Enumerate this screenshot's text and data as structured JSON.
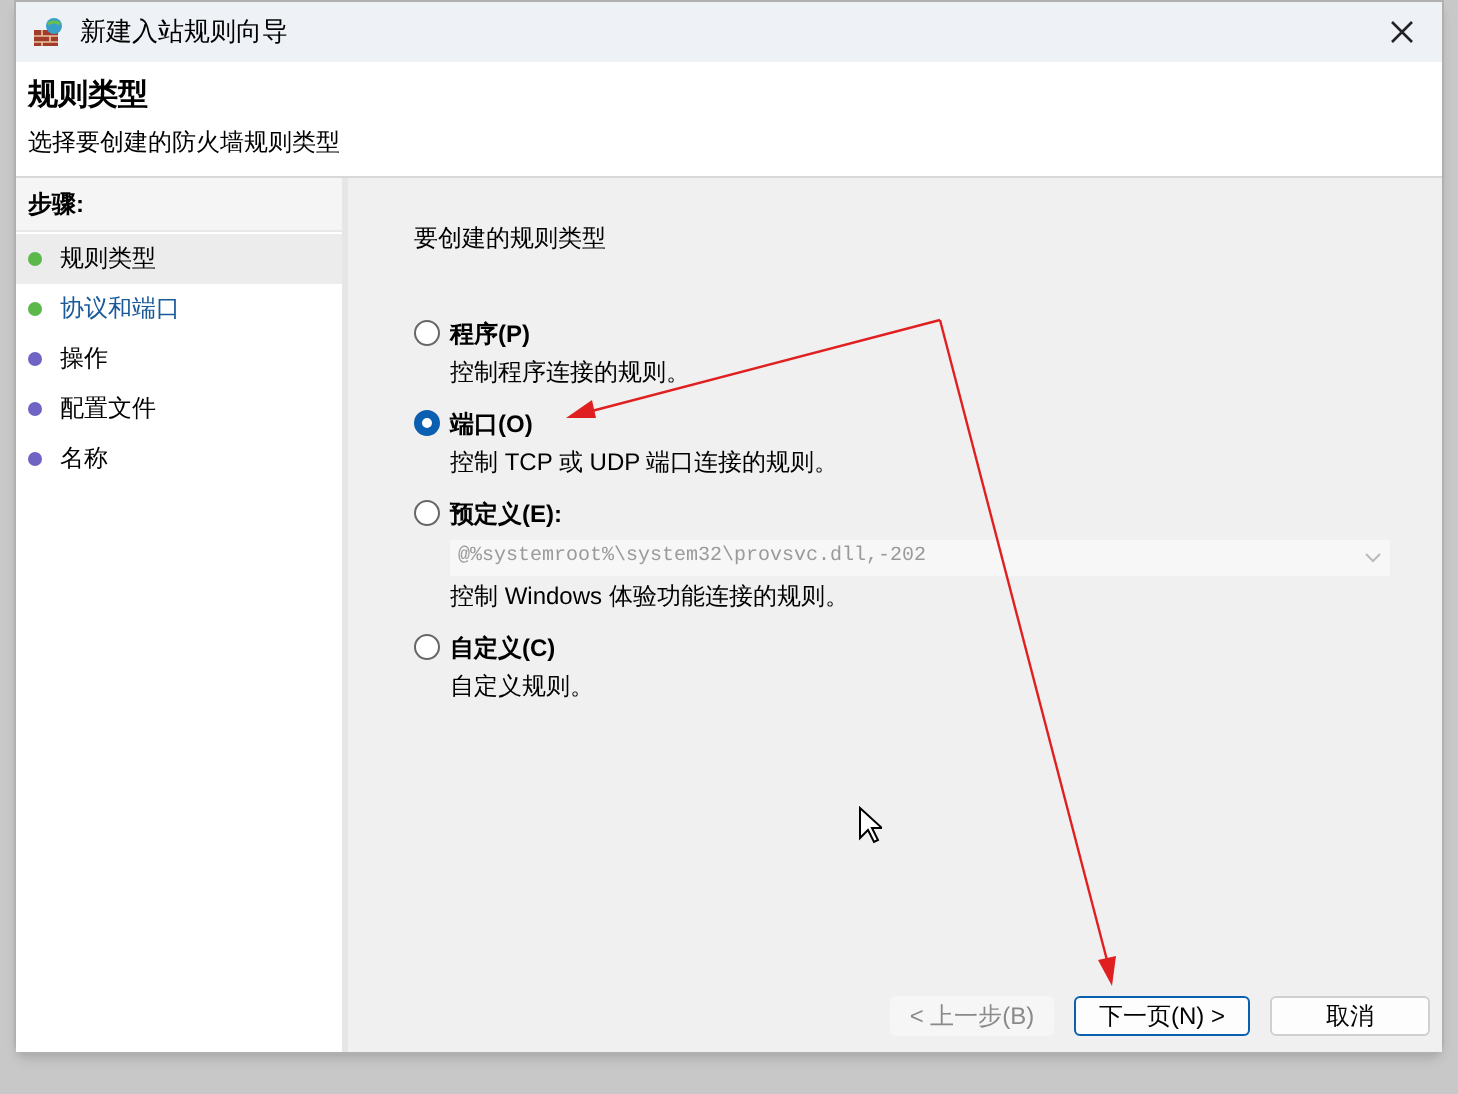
{
  "window": {
    "title": "新建入站规则向导"
  },
  "header": {
    "title": "规则类型",
    "subtitle": "选择要创建的防火墙规则类型"
  },
  "steps": {
    "heading": "步骤:",
    "items": [
      {
        "label": "规则类型",
        "selected": true,
        "hovered": false,
        "color": "#5cb84a"
      },
      {
        "label": "协议和端口",
        "selected": false,
        "hovered": true,
        "color": "#5cb84a"
      },
      {
        "label": "操作",
        "selected": false,
        "hovered": false,
        "color": "#6f63c4"
      },
      {
        "label": "配置文件",
        "selected": false,
        "hovered": false,
        "color": "#6f63c4"
      },
      {
        "label": "名称",
        "selected": false,
        "hovered": false,
        "color": "#6f63c4"
      }
    ]
  },
  "prompt": "要创建的规则类型",
  "options": [
    {
      "label": "程序(P)",
      "description": "控制程序连接的规则。",
      "selected": false
    },
    {
      "label": "端口(O)",
      "description": "控制 TCP 或 UDP 端口连接的规则。",
      "selected": true
    },
    {
      "label": "预定义(E):",
      "dropdown": {
        "value": "@%systemroot%\\system32\\provsvc.dll,-202",
        "disabled": true
      },
      "description": "控制 Windows 体验功能连接的规则。",
      "selected": false
    },
    {
      "label": "自定义(C)",
      "description": "自定义规则。",
      "selected": false
    }
  ],
  "buttons": [
    {
      "label": "< 上一步(B)",
      "disabled": true,
      "default": false
    },
    {
      "label": "下一页(N) >",
      "disabled": false,
      "default": true
    },
    {
      "label": "取消",
      "disabled": false,
      "default": false
    }
  ]
}
